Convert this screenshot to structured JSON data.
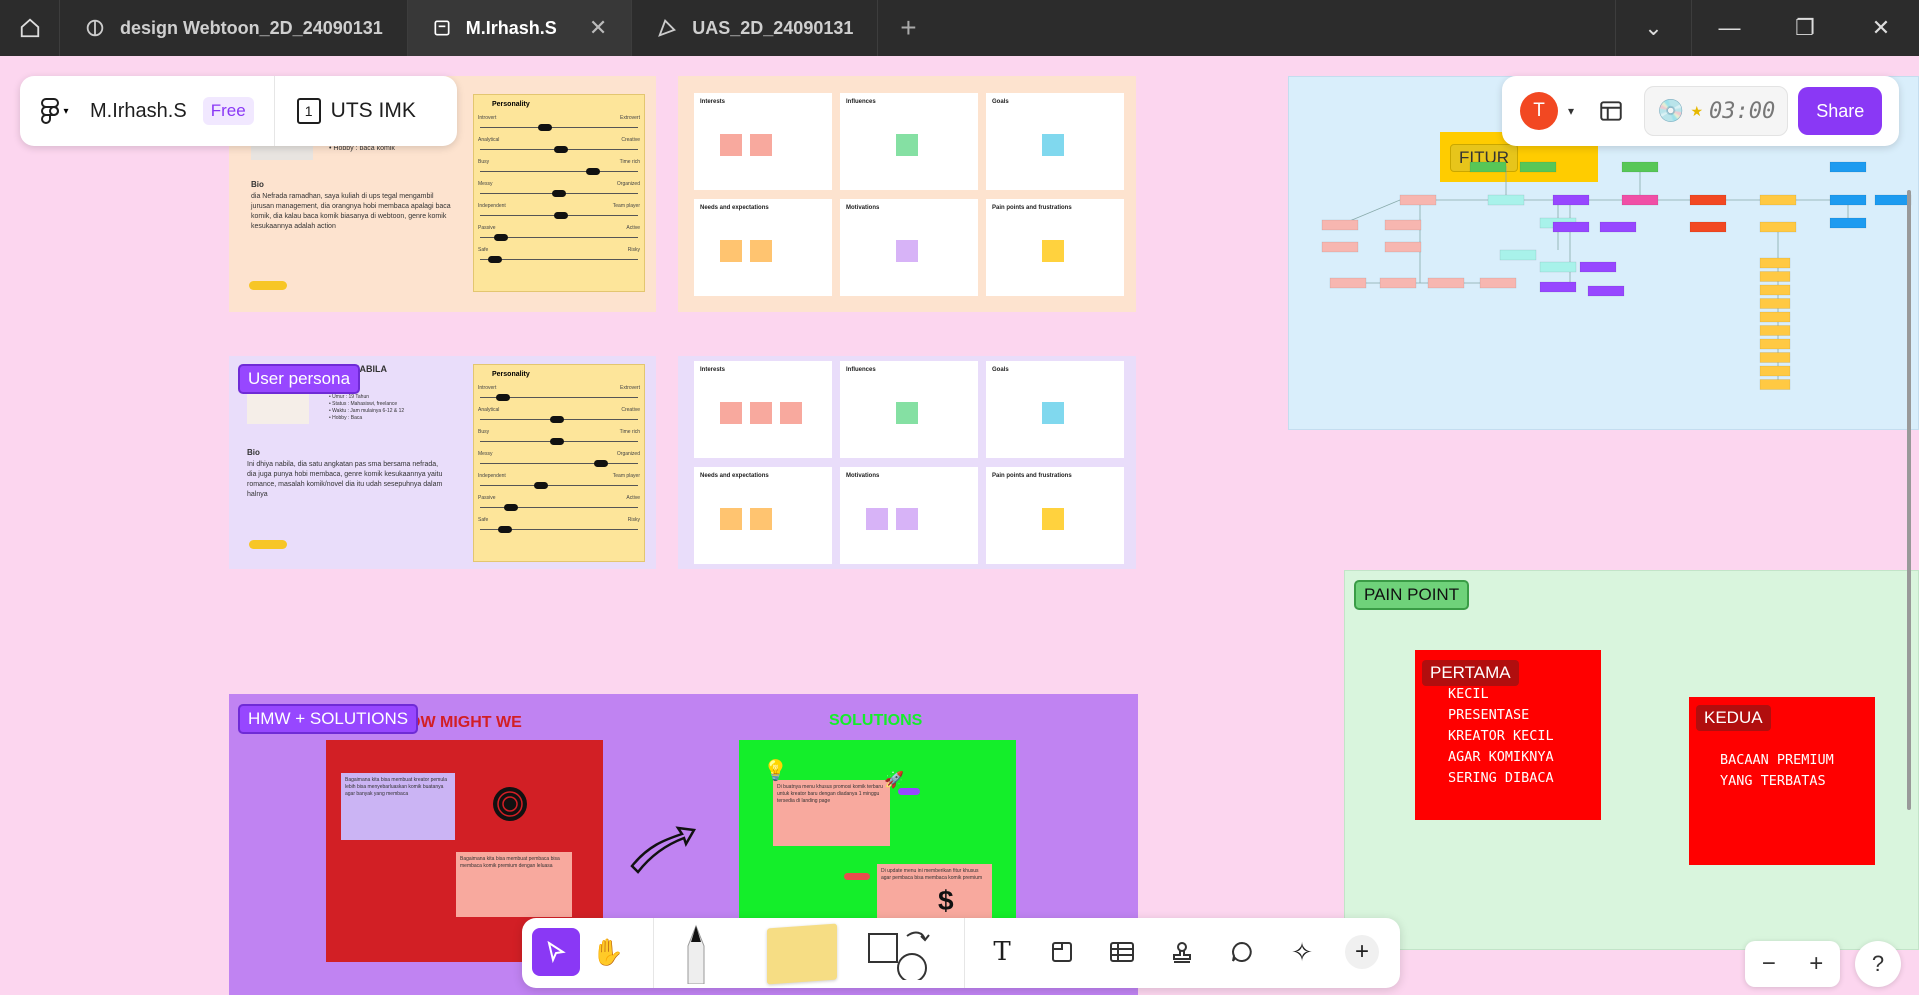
{
  "titlebar": {
    "tabs": [
      {
        "label": "design Webtoon_2D_24090131",
        "active": false
      },
      {
        "label": "M.Irhash.S",
        "active": true
      },
      {
        "label": "UAS_2D_24090131",
        "active": false
      }
    ]
  },
  "file_panel": {
    "user_name": "M.Irhash.S",
    "plan_badge": "Free",
    "page_number": "1",
    "page_name": "UTS IMK"
  },
  "share_panel": {
    "avatar_initial": "T",
    "timer": "03:00",
    "share_label": "Share"
  },
  "sections": {
    "user_persona": "User persona",
    "fitur": "FITUR",
    "pain_point": "PAIN POINT",
    "hmw_solutions": "HMW + SOLUTIONS"
  },
  "persona1": {
    "hobby": "• Hobby : baca komik",
    "bio_title": "Bio",
    "bio": "dia Nefrada ramadhan, saya kuliah di ups tegal mengambil jurusan management, dia orangnya hobi membaca apalagi baca komik, dia kalau baca komik biasanya di webtoon, genre komik kesukaannya adalah action",
    "personality_title": "Personality"
  },
  "persona2": {
    "name_fragment": "NABILA",
    "details": "• Umur : 19 Tahun\n• Status : Mahasiswi, freelance\n• Waktu : Jam mulainya 6-12 & 12\n• Hobby : Baca",
    "bio_title": "Bio",
    "bio": "Ini dhiya nabila, dia satu angkatan pas sma bersama nefrada, dia juga punya hobi membaca, genre komik kesukaannya yaitu romance, masalah komik/novel dia itu udah sesepuhnya dalam halnya",
    "personality_title": "Personality"
  },
  "personality_traits": [
    {
      "left": "Introvert",
      "right": "Extrovert"
    },
    {
      "left": "Analytical",
      "right": "Creative"
    },
    {
      "left": "Busy",
      "right": "Time rich"
    },
    {
      "left": "Messy",
      "right": "Organized"
    },
    {
      "left": "Independent",
      "right": "Team player"
    },
    {
      "left": "Passive",
      "right": "Active"
    },
    {
      "left": "Safe",
      "right": "Risky"
    }
  ],
  "empathy_cards": [
    "Interests",
    "Influences",
    "Goals",
    "Needs and expectations",
    "Motivations",
    "Pain points and frustrations"
  ],
  "pain_points": [
    {
      "title": "PERTAMA",
      "body": "KECIL\nPRESENTASE\nKREATOR KECIL\nAGAR KOMIKNYA\nSERING DIBACA"
    },
    {
      "title": "KEDUA",
      "body": "BACAAN PREMIUM\nYANG TERBATAS"
    }
  ],
  "hmw": {
    "heading_fragment": "OW MIGHT WE",
    "solutions_heading": "SOLUTIONS",
    "sticky_1": "Bagaimana kita bisa membuat kreator pemula lebih bisa menyebarluaskan komik buatanya agar banyak yang membaca",
    "sticky_2": "Bagaimana kita bisa membuat pembaca bisa membaca komik premium dengan leluasa",
    "solution_1": "Di buatnya menu khusus promosi komik terbaru untuk kreator baru dengan diadanya 1 minggu tersedia di landing page",
    "solution_2": "Di update menu ini memberikan fitur khusus agar pembaca bisa membaca komik premium"
  },
  "toolbar": {
    "tools": [
      "move-tool",
      "hand-tool",
      "pen-tool",
      "sticky-note-tool",
      "shape-tool",
      "text-tool",
      "section-tool",
      "table-tool",
      "stamp-tool",
      "comment-tool",
      "ai-tool",
      "more-tool"
    ]
  },
  "zoom": {
    "minus": "−",
    "plus": "+",
    "help": "?"
  }
}
